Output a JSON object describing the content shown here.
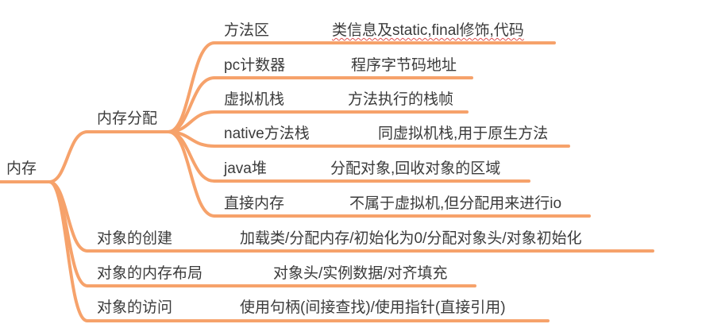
{
  "colors": {
    "branch": "#f6a26b",
    "text": "#3b3b3b",
    "background": "#ffffff",
    "spellcheck": "#e05050"
  },
  "root": {
    "label": "内存"
  },
  "branches": [
    {
      "label": "内存分配",
      "children": [
        {
          "label": "方法区",
          "note": "类信息及static,final修饰,代码"
        },
        {
          "label": "pc计数器",
          "note": "程序字节码地址"
        },
        {
          "label": "虚拟机栈",
          "note": "方法执行的栈帧"
        },
        {
          "label": "native方法栈",
          "note": "同虚拟机栈,用于原生方法"
        },
        {
          "label": "java堆",
          "note": "分配对象,回收对象的区域"
        },
        {
          "label": "直接内存",
          "note": "不属于虚拟机,但分配用来进行io"
        }
      ]
    },
    {
      "label": "对象的创建",
      "note": "加载类/分配内存/初始化为0/分配对象头/对象初始化"
    },
    {
      "label": "对象的内存布局",
      "note": "对象头/实例数据/对齐填充"
    },
    {
      "label": "对象的访问",
      "note": "使用句柄(间接查找)/使用指针(直接引用)"
    }
  ]
}
